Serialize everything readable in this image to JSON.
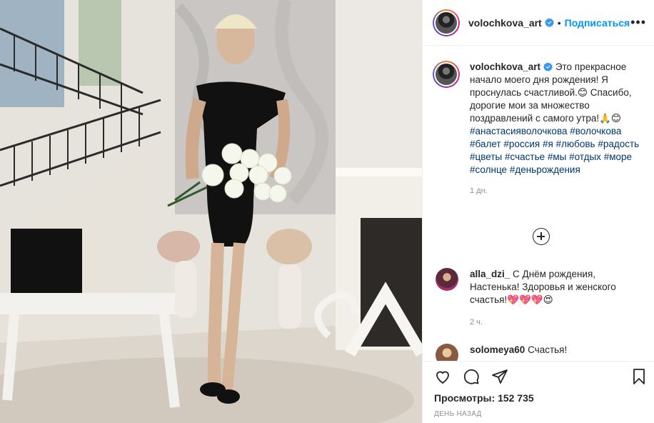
{
  "post": {
    "username": "volochkova_art",
    "dot": "•",
    "follow_label": "Подписаться",
    "more_label": "•••"
  },
  "caption": {
    "username": "volochkova_art",
    "text": "Это прекрасное начало моего дня рождения! Я проснулась счастливой.😊 Спасибо, дорогие мои за множество поздравлений с самого утра!🙏😊",
    "hashtags": [
      "#анастасияволочкова",
      "#волочкова",
      "#балет",
      "#россия",
      "#я",
      "#любовь",
      "#радость",
      "#цветы",
      "#счастье",
      "#мы",
      "#отдых",
      "#море",
      "#солнце",
      "#деньрождения"
    ],
    "time": "1 дн."
  },
  "comments": [
    {
      "username": "alla_dzi_",
      "text": "С Днём рождения, Настенька! Здоровья и женского счастья!💖💖💖😍",
      "time": "2 ч."
    },
    {
      "username": "solomeya60",
      "text": "Счастья!"
    }
  ],
  "stats": {
    "views_label": "Просмотры:",
    "views_value": "152 735",
    "date": "ДЕНЬ НАЗАД"
  },
  "icons": {
    "like": "heart-icon",
    "comment": "comment-icon",
    "share": "share-icon",
    "save": "bookmark-icon",
    "verified": "verified-badge-icon",
    "load_more": "plus-circle-icon"
  },
  "colors": {
    "link": "#0095f6",
    "hashtag": "#00376b",
    "muted": "#8e8e8e",
    "verified": "#3897f0"
  }
}
